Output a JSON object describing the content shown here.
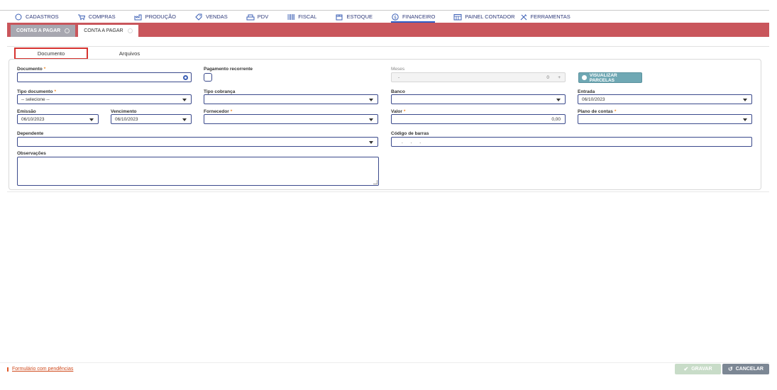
{
  "nav": {
    "items": [
      {
        "label": "CADASTROS",
        "icon": "circle-icon"
      },
      {
        "label": "COMPRAS",
        "icon": "cart-icon"
      },
      {
        "label": "PRODUÇÃO",
        "icon": "factory-icon"
      },
      {
        "label": "VENDAS",
        "icon": "tag-icon"
      },
      {
        "label": "PDV",
        "icon": "register-icon"
      },
      {
        "label": "FISCAL",
        "icon": "barcode-icon"
      },
      {
        "label": "ESTOQUE",
        "icon": "box-icon"
      },
      {
        "label": "FINANCEIRO",
        "icon": "dollar-icon"
      },
      {
        "label": "PAINEL CONTADOR",
        "icon": "calendar-icon"
      },
      {
        "label": "FERRAMENTAS",
        "icon": "tools-icon"
      }
    ],
    "accent_color": "#2f5cc4"
  },
  "page_tabs": [
    {
      "label": "CONTAS A PAGAR"
    },
    {
      "label": "CONTA A PAGAR"
    }
  ],
  "inner_tabs": [
    {
      "label": "Documento"
    },
    {
      "label": "Arquivos"
    }
  ],
  "form": {
    "documento": {
      "label": "Documento",
      "value": ""
    },
    "pagamento_recorrente": {
      "label": "Pagamento recorrente"
    },
    "meses": {
      "label": "Meses",
      "prefix": "-",
      "value": "0",
      "suffix": "+"
    },
    "visualizar_parcelas": {
      "label": "VISUALIZAR PARCELAS"
    },
    "tipo_documento": {
      "label": "Tipo documento",
      "value": "-- selecione --"
    },
    "tipo_cobranca": {
      "label": "Tipo cobrança",
      "value": ""
    },
    "banco": {
      "label": "Banco",
      "value": ""
    },
    "entrada": {
      "label": "Entrada",
      "value": "06/10/2023"
    },
    "emissao": {
      "label": "Emissão",
      "value": "06/10/2023"
    },
    "vencimento": {
      "label": "Vencimento",
      "value": "06/10/2023"
    },
    "fornecedor": {
      "label": "Fornecedor",
      "value": ""
    },
    "valor": {
      "label": "Valor",
      "value": "0,00"
    },
    "plano_contas": {
      "label": "Plano de contas",
      "value": ""
    },
    "dependente": {
      "label": "Dependente",
      "value": ""
    },
    "codigo_barras": {
      "label": "Código de barras",
      "value": "     .      .      ."
    },
    "observacoes": {
      "label": "Observações",
      "value": ""
    },
    "required_mark": "*"
  },
  "footer": {
    "pending": "Formulário com pendências",
    "gravar": "GRAVAR",
    "cancelar": "CANCELAR"
  }
}
